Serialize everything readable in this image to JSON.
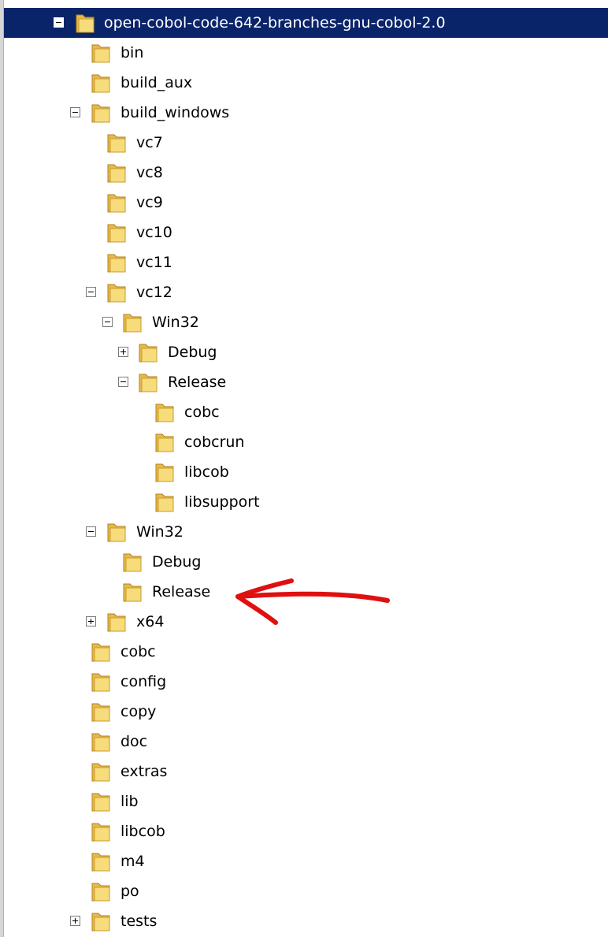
{
  "tree": {
    "root": {
      "label": "open-cobol-code-642-branches-gnu-cobol-2.0",
      "expanded": true,
      "selected": true
    },
    "items": [
      {
        "label": "bin",
        "toggle": "none"
      },
      {
        "label": "build_aux",
        "toggle": "none"
      },
      {
        "label": "build_windows",
        "toggle": "minus"
      },
      {
        "label": "vc7",
        "toggle": "none"
      },
      {
        "label": "vc8",
        "toggle": "none"
      },
      {
        "label": "vc9",
        "toggle": "none"
      },
      {
        "label": "vc10",
        "toggle": "none"
      },
      {
        "label": "vc11",
        "toggle": "none"
      },
      {
        "label": "vc12",
        "toggle": "minus"
      },
      {
        "label": "Win32",
        "toggle": "minus"
      },
      {
        "label": "Debug",
        "toggle": "plus"
      },
      {
        "label": "Release",
        "toggle": "minus"
      },
      {
        "label": "cobc",
        "toggle": "none"
      },
      {
        "label": "cobcrun",
        "toggle": "none"
      },
      {
        "label": "libcob",
        "toggle": "none"
      },
      {
        "label": "libsupport",
        "toggle": "none"
      },
      {
        "label": "Win32",
        "toggle": "minus"
      },
      {
        "label": "Debug",
        "toggle": "none"
      },
      {
        "label": "Release",
        "toggle": "none"
      },
      {
        "label": "x64",
        "toggle": "plus"
      },
      {
        "label": "cobc",
        "toggle": "none"
      },
      {
        "label": "config",
        "toggle": "none"
      },
      {
        "label": "copy",
        "toggle": "none"
      },
      {
        "label": "doc",
        "toggle": "none"
      },
      {
        "label": "extras",
        "toggle": "none"
      },
      {
        "label": "lib",
        "toggle": "none"
      },
      {
        "label": "libcob",
        "toggle": "none"
      },
      {
        "label": "m4",
        "toggle": "none"
      },
      {
        "label": "po",
        "toggle": "none"
      },
      {
        "label": "tests",
        "toggle": "plus"
      }
    ]
  },
  "colors": {
    "selection": "#0a246a",
    "annotation_arrow": "#e01010",
    "folder": "#f3d36b"
  },
  "annotation": {
    "icon": "red-arrow-icon"
  }
}
